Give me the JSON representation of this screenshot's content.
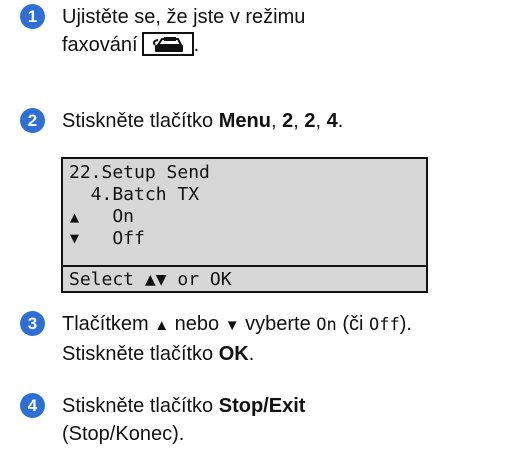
{
  "steps": [
    {
      "number": "1",
      "line1": "Ujistěte se, že jste v režimu",
      "line2": "faxování",
      "line2_after": ".",
      "fax_button_icon": "fax-icon"
    },
    {
      "number": "2",
      "prefix": "Stiskněte tlačítko ",
      "b1": "Menu",
      "s1": ", ",
      "b2": "2",
      "s2": ", ",
      "b3": "2",
      "s3": ", ",
      "b4": "4",
      "s4": "."
    },
    {
      "number": "3",
      "t1": "Tlačítkem ",
      "up_arrow": "▲",
      "t2": " nebo ",
      "down_arrow": "▼",
      "t3": " vyberte ",
      "on": "On",
      "t4": " (či ",
      "off": "Off",
      "t5": ").",
      "line2_prefix": "Stiskněte tlačítko ",
      "line2_bold": "OK",
      "line2_suffix": "."
    },
    {
      "number": "4",
      "prefix": "Stiskněte tlačítko ",
      "bold": "Stop/Exit",
      "line2": "(Stop/Konec)."
    }
  ],
  "lcd": {
    "line1": "22.Setup Send",
    "line2": "  4.Batch TX",
    "up_arrow": "▲",
    "line3": "    On",
    "down_arrow": "▼",
    "line4": "    Off",
    "footer": "Select ▲▼ or OK"
  },
  "colors": {
    "step_badge": "#2e6fd6",
    "lcd_background": "#d7d7d7"
  }
}
